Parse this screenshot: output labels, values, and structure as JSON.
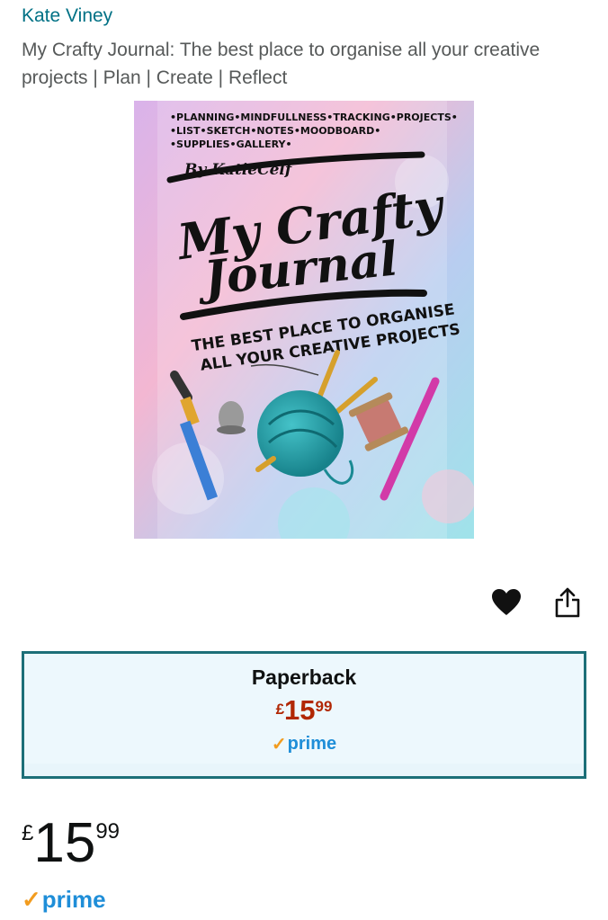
{
  "product": {
    "author": "Kate Viney",
    "title": "My Crafty Journal: The best place to organise all your creative projects | Plan | Create | Reflect"
  },
  "cover": {
    "top_text_line1": "•PLANNING•MINDFULLNESS•TRACKING•PROJECTS•",
    "top_text_line2": "•LIST•SKETCH•NOTES•MOODBOARD•",
    "top_text_line3": "•SUPPLIES•GALLERY•",
    "byline": "By KatieCelf",
    "script_title_1": "My Crafty",
    "script_title_2": "Journal",
    "subtitle_1": "THE BEST PLACE TO ORGANISE",
    "subtitle_2": "ALL YOUR CREATIVE PROJECTS"
  },
  "actions": {
    "wishlist_icon": "heart-icon",
    "share_icon": "share-icon"
  },
  "format": {
    "name": "Paperback",
    "currency": "£",
    "price_whole": "15",
    "price_fraction": "99",
    "prime_check": "✓",
    "prime_label": "prime"
  },
  "price": {
    "currency": "£",
    "whole": "15",
    "fraction": "99"
  },
  "prime": {
    "check": "✓",
    "label": "prime"
  },
  "colors": {
    "link": "#007185",
    "price_red": "#b12704",
    "prime_blue": "#1f8ed8",
    "prime_orange": "#f29c1f",
    "format_border": "#1c6f78",
    "format_bg": "#edf8fd"
  }
}
